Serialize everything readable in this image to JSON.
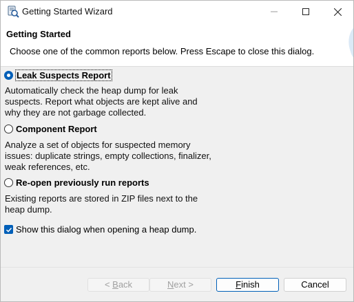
{
  "window": {
    "title": "Getting Started Wizard",
    "icons": {
      "app": "report-wizard-icon",
      "minimize": "minimize-icon",
      "maximize": "maximize-icon",
      "close": "close-icon"
    }
  },
  "header": {
    "title": "Getting Started",
    "description": "Choose one of the common reports below. Press Escape to close this dialog."
  },
  "options": [
    {
      "label": "Leak Suspects Report",
      "selected": true,
      "description": [
        "Automatically check the heap dump for leak",
        "suspects. Report what objects are kept alive and",
        "why they are not garbage collected."
      ]
    },
    {
      "label": "Component Report",
      "selected": false,
      "description": [
        "Analyze a set of objects for suspected memory",
        "issues: duplicate strings, empty collections, finalizer,",
        "weak references, etc."
      ]
    },
    {
      "label": "Re-open previously run reports",
      "selected": false,
      "description": [
        "Existing reports are stored in ZIP files next to the",
        "heap dump."
      ]
    }
  ],
  "show_dialog_checkbox": {
    "label": "Show this dialog when opening a heap dump.",
    "checked": true
  },
  "buttons": {
    "back": {
      "prefix": "< ",
      "mnemonic": "B",
      "rest": "ack",
      "enabled": false
    },
    "next": {
      "prefix": "",
      "mnemonic": "N",
      "rest": "ext >",
      "enabled": false
    },
    "finish": {
      "prefix": "",
      "mnemonic": "F",
      "rest": "inish",
      "enabled": true
    },
    "cancel": {
      "label": "Cancel",
      "enabled": true
    }
  },
  "colors": {
    "accent": "#005fb8",
    "background": "#f0f0f0",
    "header_background": "#ffffff"
  }
}
